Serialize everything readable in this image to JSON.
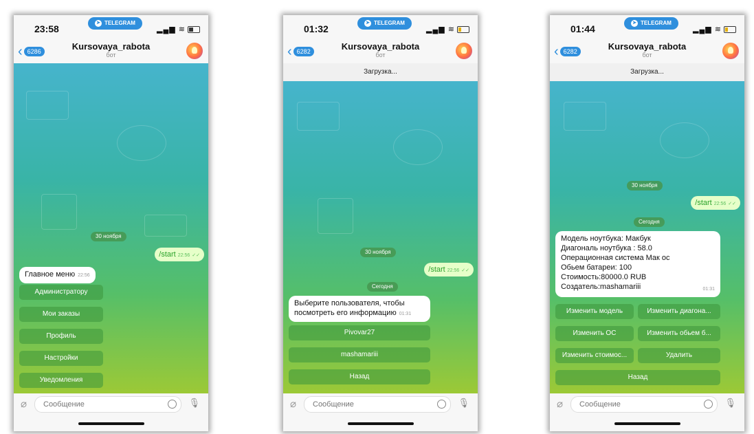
{
  "common": {
    "telegram_pill": "TELEGRAM",
    "chat_title": "Kursovaya_rabota",
    "chat_subtitle": "бот",
    "input_placeholder": "Сообщение",
    "date_nov30": "30 ноября",
    "date_today": "Сегодня",
    "start_cmd": "/start",
    "start_time": "22:56"
  },
  "screens": [
    {
      "time": "23:58",
      "back_count": "6286",
      "menu_msg": "Главное меню",
      "menu_msg_time": "22:56",
      "buttons": [
        "Администратору",
        "Мои заказы",
        "Профиль",
        "Настройки",
        "Уведомления"
      ]
    },
    {
      "time": "01:32",
      "back_count": "6282",
      "loading": "Загрузка...",
      "msg": "Выберите пользователя, чтобы посмотреть его информацию",
      "msg_time": "01:31",
      "buttons": [
        "Pivovar27",
        "mashamariii",
        "Назад"
      ]
    },
    {
      "time": "01:44",
      "back_count": "6282",
      "loading": "Загрузка...",
      "info_lines": [
        "Модель ноутбука: Макбук",
        "Диагональ ноутбука : 58.0",
        "Операционная система Мак ос",
        "Обьем батареи: 100",
        "Стоимость:80000.0 RUB",
        "Создатель:mashamariii"
      ],
      "info_time": "01:31",
      "buttons": [
        "Изменить модель",
        "Изменить диагона...",
        "Изменить ОС",
        "Изменить обьем б...",
        "Изменить стоимос...",
        "Удалить",
        "Назад"
      ]
    }
  ]
}
